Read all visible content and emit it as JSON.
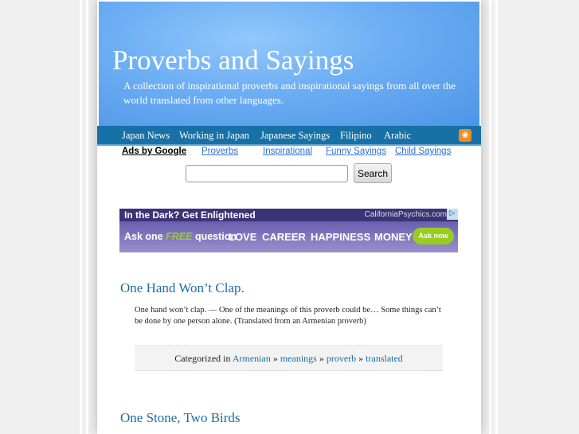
{
  "header": {
    "title": "Proverbs and Sayings",
    "tagline": "A collection of inspirational proverbs and inspirational sayings from all over the world translated from other languages."
  },
  "nav": {
    "items": [
      "Japan News",
      "Working in Japan",
      "Japanese Sayings",
      "Filipino",
      "Arabic"
    ],
    "rss_icon": "rss-icon"
  },
  "ad_links": {
    "label": "Ads by Google",
    "items": [
      "Proverbs",
      "Inspirational",
      "Funny Sayings",
      "Child Sayings"
    ]
  },
  "search": {
    "value": "",
    "button": "Search"
  },
  "banner": {
    "headline": "In the Dark? Get Enlightened",
    "brand": "CaliforniaPsychics.com",
    "ask_pre": "Ask one",
    "free": "FREE",
    "ask_post": "question",
    "topics": [
      "LOVE",
      "CAREER",
      "HAPPINESS",
      "MONEY"
    ],
    "cta": "Ask now",
    "accent": "#99cc22"
  },
  "posts": [
    {
      "title": "One Hand Won’t Clap.",
      "body": "One hand won’t clap. — One of the meanings of this proverb could be… Some things can’t be done by one person alone. (Translated from an Armenian proverb)",
      "categorized_label": "Categorized in",
      "categories": [
        "Armenian",
        "meanings",
        "proverb",
        "translated"
      ],
      "sep": "»"
    },
    {
      "title": "One Stone, Two Birds"
    }
  ]
}
